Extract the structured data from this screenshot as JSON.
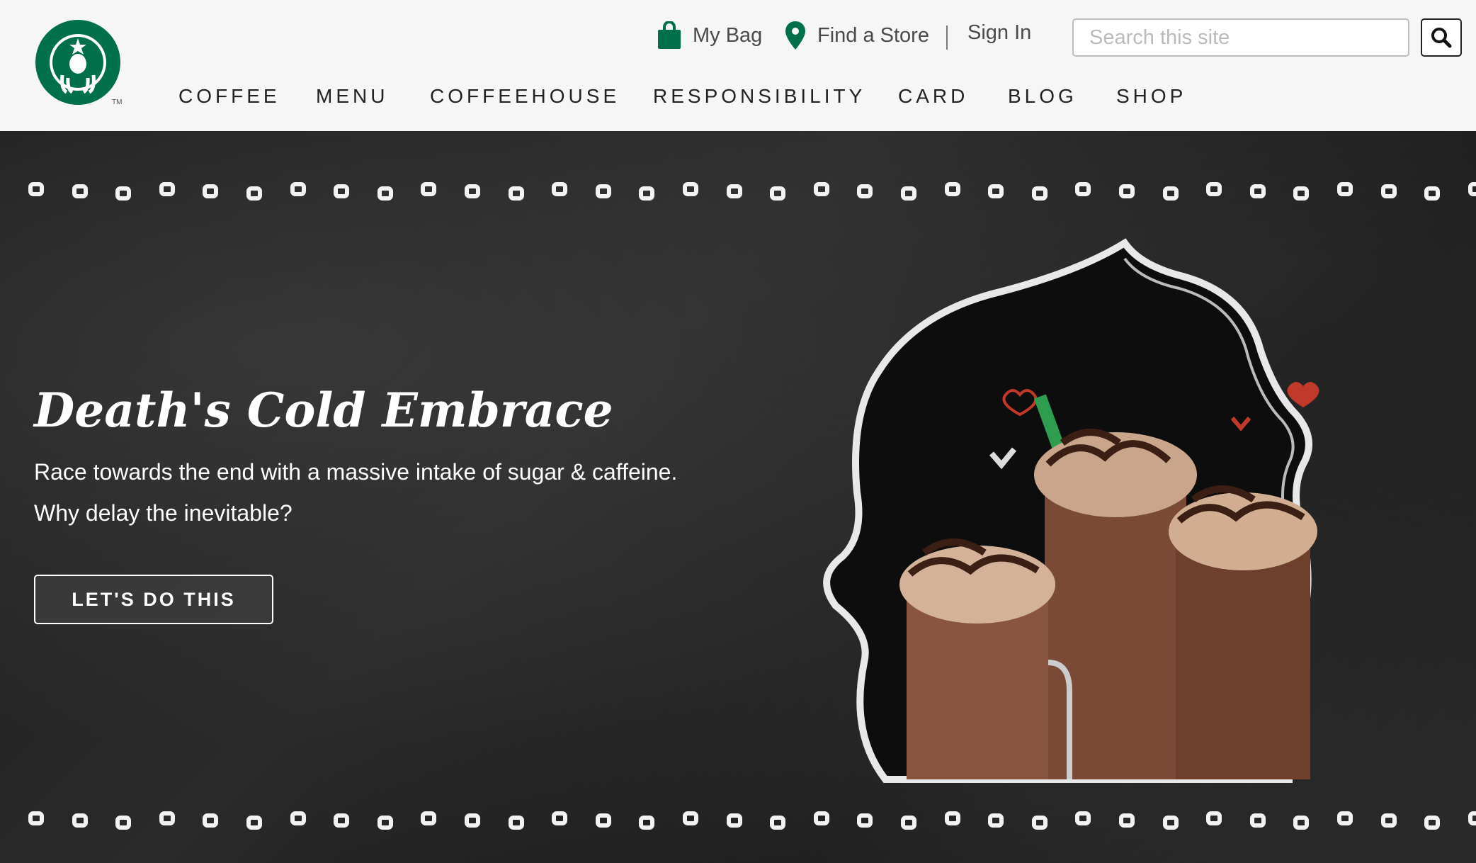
{
  "brand": {
    "logo_icon": "siren-logo-icon",
    "colors": {
      "green": "#00704a",
      "dark_green": "#006241"
    }
  },
  "utility": {
    "bag_label": "My Bag",
    "bag_icon": "shopping-bag-icon",
    "store_label": "Find a Store",
    "store_icon": "location-pin-icon",
    "signin_label": "Sign In"
  },
  "search": {
    "placeholder": "Search this site",
    "value": "",
    "button_icon": "search-icon"
  },
  "nav": {
    "items": [
      {
        "label": "COFFEE"
      },
      {
        "label": "MENU"
      },
      {
        "label": "COFFEEHOUSE"
      },
      {
        "label": "RESPONSIBILITY"
      },
      {
        "label": "CARD"
      },
      {
        "label": "BLOG"
      },
      {
        "label": "SHOP"
      }
    ]
  },
  "hero": {
    "title": "Death's Cold Embrace",
    "line1": "Race towards the end with a massive intake of sugar & caffeine.",
    "line2": "Why delay the inevitable?",
    "cta": "LET'S DO THIS",
    "image_icon": "frappuccino-drinks-illustration"
  }
}
